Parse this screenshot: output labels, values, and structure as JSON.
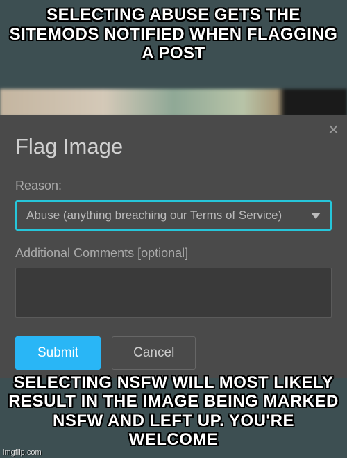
{
  "meme": {
    "top_text": "SELECTING ABUSE GETS THE SITEMODS NOTIFIED WHEN FLAGGING A POST",
    "bottom_text": "SELECTING NSFW WILL MOST LIKELY RESULT IN THE IMAGE BEING MARKED NSFW AND LEFT UP. YOU'RE WELCOME",
    "watermark": "imgflip.com"
  },
  "dialog": {
    "title": "Flag Image",
    "close_symbol": "×",
    "reason_label": "Reason:",
    "reason_selected": "Abuse (anything breaching our Terms of Service)",
    "comments_label": "Additional Comments [optional]",
    "comments_value": "",
    "submit_label": "Submit",
    "cancel_label": "Cancel"
  }
}
